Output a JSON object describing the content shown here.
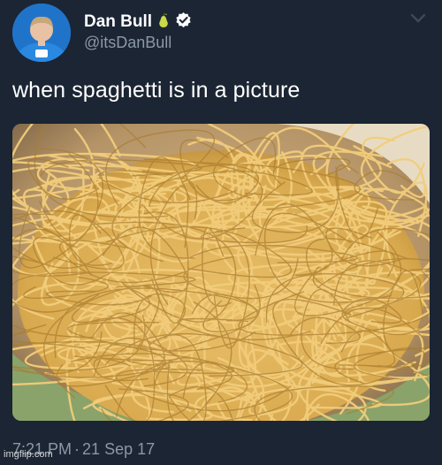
{
  "tweet": {
    "author": {
      "display_name": "Dan Bull",
      "handle": "@itsDanBull",
      "name_emoji": "pear-icon",
      "verified": true
    },
    "text": "when spaghetti is in a picture",
    "image": {
      "subject": "spaghetti-photo"
    },
    "time": "7:21 PM",
    "separator": "·",
    "date": "21 Sep 17"
  },
  "watermark": "imgflip.com",
  "colors": {
    "background": "#1b2533",
    "secondary_text": "#8b98a8",
    "verified_badge": "#ffffff",
    "pasta": "#e0b45e"
  }
}
